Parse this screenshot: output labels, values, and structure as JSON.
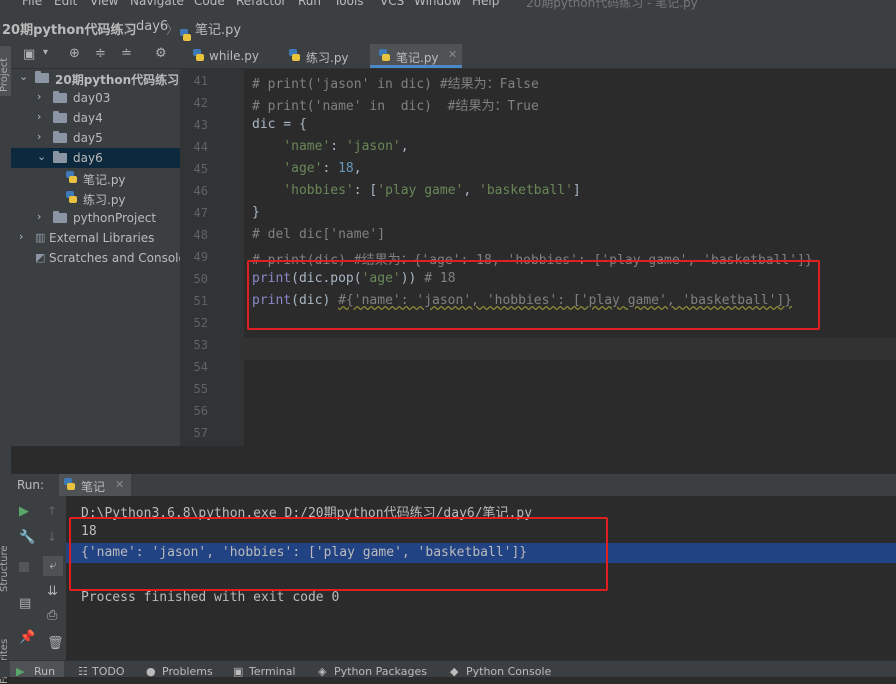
{
  "menu": [
    "File",
    "Edit",
    "View",
    "Navigate",
    "Code",
    "Refactor",
    "Run",
    "Tools",
    "VCS",
    "Window",
    "Help",
    "20期python代码练习 - 笔记.py"
  ],
  "breadcrumb": [
    "20期python代码练习",
    "day6",
    "笔记.py"
  ],
  "side_labels": {
    "project": "Project",
    "structure": "Structure",
    "favorites": "Favorites"
  },
  "project_tree": [
    {
      "label": "20期python代码练习",
      "type": "folder",
      "expanded": true
    },
    {
      "label": "day03",
      "type": "folder"
    },
    {
      "label": "day4",
      "type": "folder"
    },
    {
      "label": "day5",
      "type": "folder"
    },
    {
      "label": "day6",
      "type": "folder",
      "expanded": true
    },
    {
      "label": "笔记.py",
      "type": "file"
    },
    {
      "label": "练习.py",
      "type": "file"
    },
    {
      "label": "pythonProject",
      "type": "folder"
    },
    {
      "label": "External Libraries",
      "type": "lib"
    },
    {
      "label": "Scratches and Consoles",
      "type": "scratch"
    }
  ],
  "tabs": [
    {
      "label": "while.py"
    },
    {
      "label": "练习.py"
    },
    {
      "label": "笔记.py",
      "active": true
    }
  ],
  "line_numbers": [
    "41",
    "42",
    "43",
    "44",
    "45",
    "46",
    "47",
    "48",
    "49",
    "50",
    "51",
    "52",
    "53",
    "54",
    "55",
    "56",
    "57"
  ],
  "code_lines": [
    [
      {
        "t": "# print('jason' in dic) #结果为：False",
        "c": "cm"
      }
    ],
    [
      {
        "t": "# print('name' in  dic)  #结果为：True",
        "c": "cm"
      }
    ],
    [
      {
        "t": "dic = {",
        "c": ""
      }
    ],
    [
      {
        "t": "    ",
        "c": ""
      },
      {
        "t": "'name'",
        "c": "st"
      },
      {
        "t": ": ",
        "c": ""
      },
      {
        "t": "'jason'",
        "c": "st"
      },
      {
        "t": ",",
        "c": ""
      }
    ],
    [
      {
        "t": "    ",
        "c": ""
      },
      {
        "t": "'age'",
        "c": "st"
      },
      {
        "t": ": ",
        "c": ""
      },
      {
        "t": "18",
        "c": "nu"
      },
      {
        "t": ",",
        "c": ""
      }
    ],
    [
      {
        "t": "    ",
        "c": ""
      },
      {
        "t": "'hobbies'",
        "c": "st"
      },
      {
        "t": ": [",
        "c": ""
      },
      {
        "t": "'play game'",
        "c": "st"
      },
      {
        "t": ", ",
        "c": ""
      },
      {
        "t": "'basketball'",
        "c": "st"
      },
      {
        "t": "]",
        "c": ""
      }
    ],
    [
      {
        "t": "}",
        "c": ""
      }
    ],
    [
      {
        "t": "# del dic['name']",
        "c": "cm"
      }
    ],
    [
      {
        "t": "# print(dic) #结果为：{'age': 18, 'hobbies': ['play game', 'basketball']}",
        "c": "cm"
      }
    ],
    [
      {
        "t": "print",
        "c": "fn"
      },
      {
        "t": "(dic.pop(",
        "c": ""
      },
      {
        "t": "'age'",
        "c": "st"
      },
      {
        "t": "))",
        "c": ""
      },
      {
        "t": " # 18",
        "c": "cm"
      }
    ],
    [
      {
        "t": "print",
        "c": "fn"
      },
      {
        "t": "(dic) ",
        "c": ""
      },
      {
        "t": "#{'name': 'jason', 'hobbies': ['play game', 'basketball']}",
        "c": "cm wavy"
      }
    ],
    [],
    [],
    [],
    [],
    [],
    []
  ],
  "run": {
    "label": "Run:",
    "tab": "笔记",
    "output": [
      "D:\\Python3.6.8\\python.exe D:/20期python代码练习/day6/笔记.py",
      "18",
      "{'name': 'jason', 'hobbies': ['play game', 'basketball']}",
      "",
      "Process finished with exit code 0"
    ]
  },
  "bottom_tabs": [
    "Run",
    "TODO",
    "Problems",
    "Terminal",
    "Python Packages",
    "Python Console"
  ]
}
